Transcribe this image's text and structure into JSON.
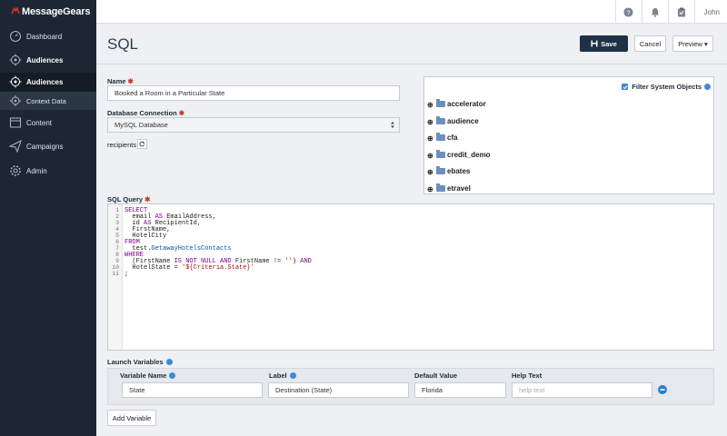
{
  "app": {
    "brand": "MessageGears",
    "user": "John"
  },
  "sidebar": {
    "items": [
      {
        "label": "Dashboard"
      },
      {
        "label": "Audiences"
      },
      {
        "label": "Audiences"
      },
      {
        "label": "Context Data"
      },
      {
        "label": "Content"
      },
      {
        "label": "Campaigns"
      },
      {
        "label": "Admin"
      }
    ]
  },
  "header": {
    "title": "SQL",
    "save_label": "Save",
    "cancel_label": "Cancel",
    "preview_label": "Preview ▾"
  },
  "form": {
    "name_label": "Name",
    "name_value": "Booked a Room in a Particular State",
    "db_label": "Database Connection",
    "db_value": "MySQL Database",
    "recipients_label": "recipients",
    "filter_label": "Filter System Objects",
    "sql_label": "SQL Query"
  },
  "tree": {
    "items": [
      "accelerator",
      "audience",
      "cfa",
      "credit_demo",
      "ebates",
      "etravel"
    ]
  },
  "sql": {
    "line_numbers": [
      "1",
      "2",
      "3",
      "4",
      "5",
      "6",
      "7",
      "8",
      "9",
      "10",
      "11"
    ]
  },
  "launch_vars": {
    "title": "Launch Variables",
    "headers": {
      "name": "Variable Name",
      "label": "Label",
      "default": "Default Value",
      "help": "Help Text"
    },
    "row": {
      "name": "State",
      "label": "Destination (State)",
      "default": "Florida",
      "help_placeholder": "help text"
    },
    "add_label": "Add Variable"
  }
}
